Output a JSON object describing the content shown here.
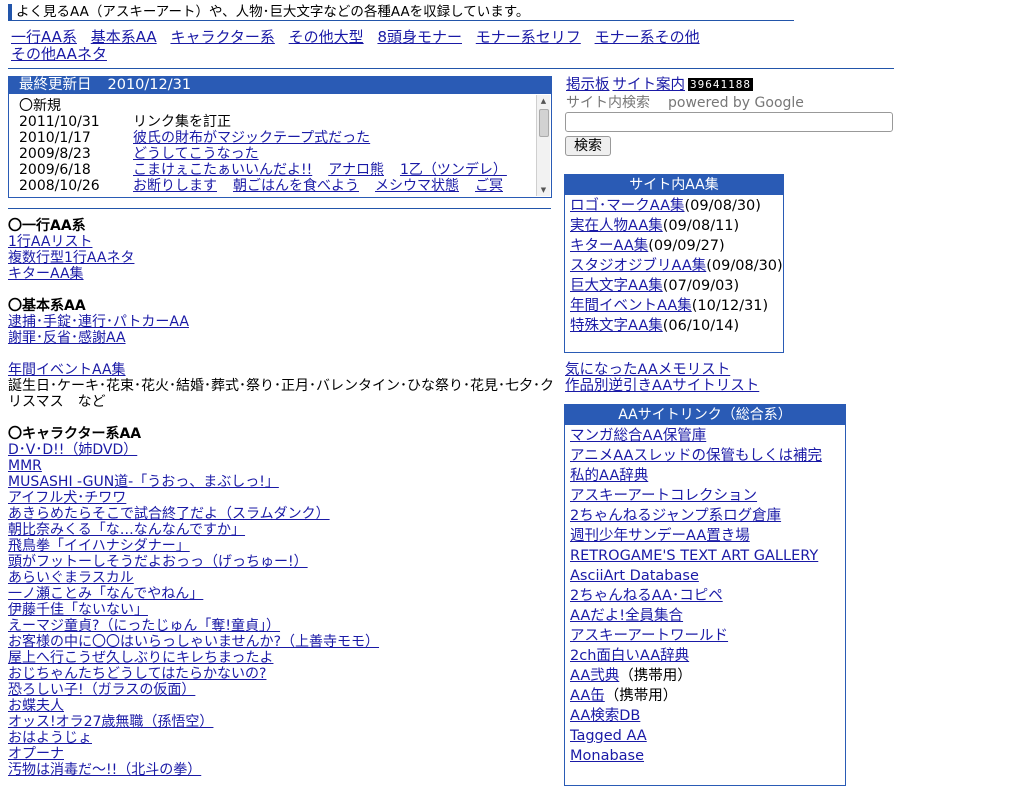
{
  "tagline": "よく見るAA（アスキーアート）や、人物･巨大文字などの各種AAを収録しています。",
  "nav": [
    "一行AA系",
    "基本系AA",
    "キャラクター系",
    "その他大型",
    "8頭身モナー",
    "モナー系セリフ",
    "モナー系その他",
    "その他AAネタ"
  ],
  "updates": {
    "header_label": "最終更新日",
    "header_date": "2010/12/31",
    "new_label": "〇新規",
    "rows": [
      {
        "date": "2011/10/31",
        "text": "リンク集を訂正",
        "links": []
      },
      {
        "date": "2010/1/17",
        "links": [
          "彼氏の財布がマジックテープ式だった"
        ]
      },
      {
        "date": "2009/8/23",
        "links": [
          "どうしてこうなった"
        ]
      },
      {
        "date": "2009/6/18",
        "links": [
          "こまけぇこたぁいいんだよ!!",
          "アナロ熊",
          "1乙（ツンデレ）"
        ]
      },
      {
        "date": "2008/10/26",
        "links": [
          "お断りします",
          "朝ごはんを食べよう",
          "メシウマ状態",
          "ご冥"
        ]
      }
    ]
  },
  "sections": {
    "one_line": {
      "title": "〇一行AA系",
      "links": [
        "1行AAリスト",
        "複数行型1行AAネタ",
        "キターAA集"
      ]
    },
    "basic": {
      "title": "〇基本系AA",
      "links": [
        "逮捕･手錠･連行･パトカーAA",
        "謝罪･反省･感謝AA"
      ]
    },
    "event": {
      "link": "年間イベントAA集",
      "desc": "誕生日･ケーキ･花束･花火･結婚･葬式･祭り･正月･バレンタイン･ひな祭り･花見･七夕･クリスマス　など"
    },
    "character": {
      "title": "〇キャラクター系AA",
      "links": [
        "D･V･D!!（姉DVD）",
        "MMR",
        "MUSASHI -GUN道-「うおっ、まぶしっ!」",
        "アイフル犬･チワワ",
        "あきらめたらそこで試合終了だよ（スラムダンク）",
        "朝比奈みくる「な…なんなんですか」",
        "飛鳥拳「イイハナシダナー」",
        "頭がフットーしそうだよおっっ（げっちゅー!）",
        "あらいぐまラスカル",
        "一ノ瀬ことみ「なんでやねん」",
        "伊藤千佳「ないない」",
        "えーマジ童貞?（にったじゅん「奪!童貞」）",
        "お客様の中に〇〇はいらっしゃいませんか?（上善寺モモ）",
        "屋上へ行こうぜ久しぶりにキレちまったよ",
        "おじちゃんたちどうしてはたらかないの?",
        "恐ろしい子!（ガラスの仮面）",
        "お蝶夫人",
        "オッス!オラ27歳無職（孫悟空）",
        "おはようじょ",
        "オプーナ",
        "汚物は消毒だ～!!（北斗の拳）"
      ]
    }
  },
  "right": {
    "bbs": "掲示板",
    "guide": "サイト案内",
    "counter": "39641188",
    "search_label": "サイト内検索",
    "powered": "powered by Google",
    "search_value": "",
    "search_button": "検索",
    "site_aa": {
      "title": "サイト内AA集",
      "items": [
        {
          "link": "ロゴ･マークAA集",
          "date": "(09/08/30)"
        },
        {
          "link": "実在人物AA集",
          "date": "(09/08/11)"
        },
        {
          "link": "キターAA集",
          "date": "(09/09/27)"
        },
        {
          "link": "スタジオジブリAA集",
          "date": "(09/08/30)"
        },
        {
          "link": "巨大文字AA集",
          "date": "(07/09/03)"
        },
        {
          "link": "年間イベントAA集",
          "date": "(10/12/31)"
        },
        {
          "link": "特殊文字AA集",
          "date": "(06/10/14)"
        }
      ]
    },
    "extra_links": [
      "気になったAAメモリスト",
      "作品別逆引きAAサイトリスト"
    ],
    "aa_links": {
      "title": "AAサイトリンク（総合系）",
      "items": [
        {
          "link": "マンガ総合AA保管庫",
          "suffix": ""
        },
        {
          "link": "アニメAAスレッドの保管もしくは補完",
          "suffix": ""
        },
        {
          "link": "私的AA辞典",
          "suffix": ""
        },
        {
          "link": "アスキーアートコレクション",
          "suffix": ""
        },
        {
          "link": "2ちゃんねるジャンプ系ログ倉庫",
          "suffix": ""
        },
        {
          "link": "週刊少年サンデーAA置き場",
          "suffix": ""
        },
        {
          "link": "RETROGAME'S TEXT ART GALLERY",
          "suffix": ""
        },
        {
          "link": "AsciiArt Database",
          "suffix": ""
        },
        {
          "link": "2ちゃんねるAA･コピペ",
          "suffix": ""
        },
        {
          "link": "AAだよ!全員集合",
          "suffix": ""
        },
        {
          "link": "アスキーアートワールド",
          "suffix": ""
        },
        {
          "link": "2ch面白いAA辞典",
          "suffix": ""
        },
        {
          "link": "AA弐典",
          "suffix": "（携帯用）"
        },
        {
          "link": "AA缶",
          "suffix": "（携帯用）"
        },
        {
          "link": "AA検索DB",
          "suffix": ""
        },
        {
          "link": "Tagged AA",
          "suffix": ""
        },
        {
          "link": "Monabase",
          "suffix": ""
        }
      ]
    }
  }
}
